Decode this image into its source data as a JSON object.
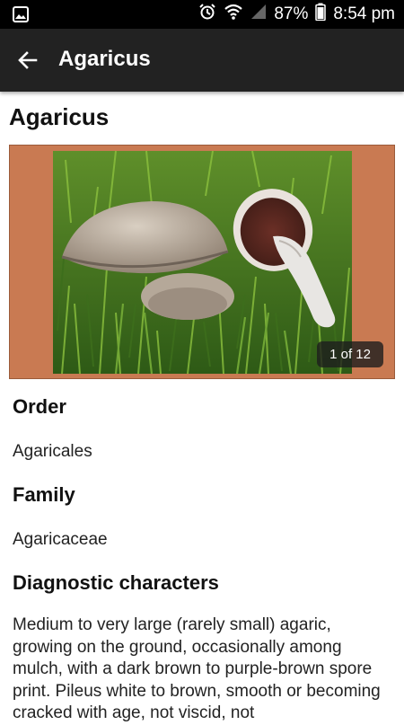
{
  "status_bar": {
    "battery": "87%",
    "time": "8:54 pm"
  },
  "app_bar": {
    "title": "Agaricus"
  },
  "page": {
    "title": "Agaricus"
  },
  "gallery": {
    "counter": "1 of 12",
    "image_subject": "mushrooms on grass"
  },
  "sections": {
    "order": {
      "heading": "Order",
      "value": "Agaricales"
    },
    "family": {
      "heading": "Family",
      "value": "Agaricaceae"
    },
    "diagnostic": {
      "heading": "Diagnostic characters",
      "text": "Medium to very large (rarely small) agaric, growing on the ground, occasionally among mulch, with a dark brown to purple-brown spore print. Pileus white to brown, smooth or becoming cracked with age, not viscid, not"
    }
  },
  "colors": {
    "status_bar": "#000000",
    "app_bar": "#222222",
    "gallery_frame": "#c97a52"
  }
}
